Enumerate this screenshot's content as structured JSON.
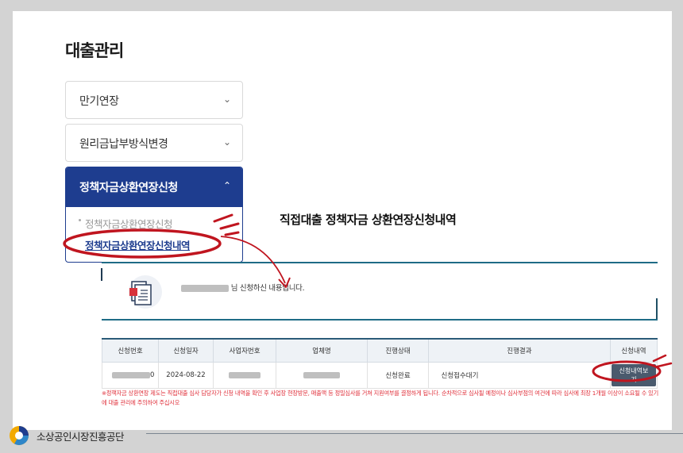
{
  "page_title": "대출관리",
  "accordion": {
    "items": [
      {
        "label": "만기연장",
        "chevron": "chevron-down-icon"
      },
      {
        "label": "원리금납부방식변경",
        "chevron": "chevron-down-icon"
      },
      {
        "label": "정책자금상환연장신청",
        "chevron": "chevron-up-icon",
        "children": [
          "정책자금상환연장신청",
          "정책자금상환연장신청내역"
        ]
      }
    ]
  },
  "section": {
    "heading": "직접대출 정책자금 상환연장신청내역",
    "message_suffix": "님 신청하신 내용입니다."
  },
  "table": {
    "headers": [
      "신청번호",
      "신청일자",
      "사업자번호",
      "업체명",
      "진행상태",
      "진행결과",
      "신청내역"
    ],
    "rows": [
      {
        "number_suffix": "0",
        "date": "2024-08-22",
        "status": "신청완료",
        "result": "신청접수대기",
        "action": "신청내역보기"
      }
    ]
  },
  "notice": "※정책자금 상환연장 제도는 직접대출 심사 담당자가 신청 내역을 확인 후 사업장 현장방문, 매출액 등 정밀심사를 거쳐 지원여부를 결정하게 됩니다. 순차적으로 심사될 예정이나 심사부점의 여건에 따라 심사에 최장 1개월 이상이 소요될 수 있기에 대출 관리에 주의하여 주십시오",
  "footer": {
    "org_name": "소상공인시장진흥공단"
  },
  "colors": {
    "navy": "#1e3d8f",
    "highlight_red": "#c0151f",
    "teal_line": "#1f6c86",
    "notice_red": "#e0303b"
  }
}
